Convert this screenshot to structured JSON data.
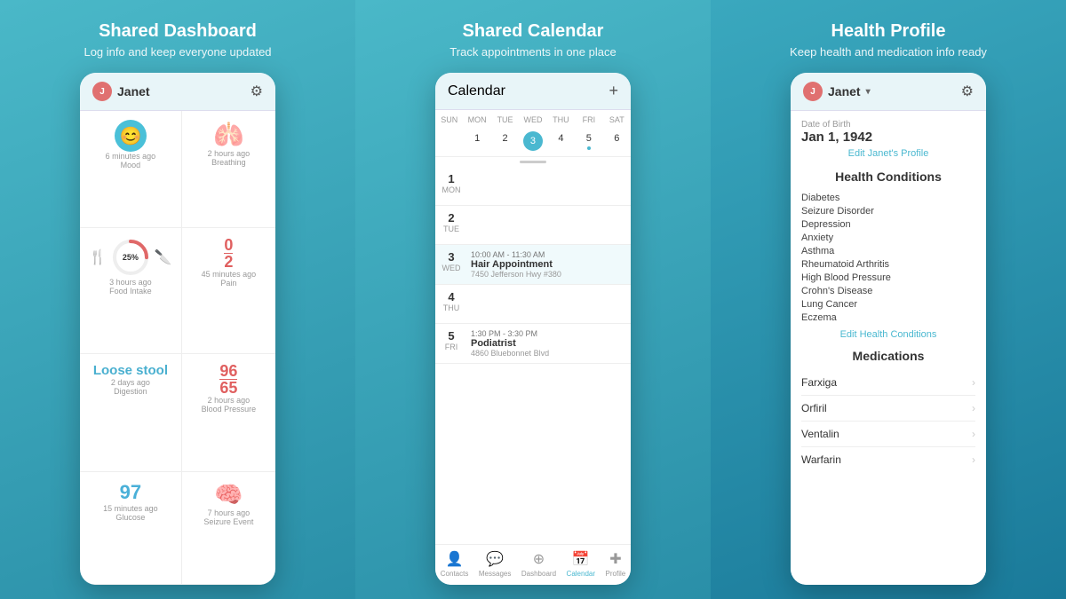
{
  "panel1": {
    "title": "Shared Dashboard",
    "subtitle": "Log info and keep everyone updated",
    "header": {
      "user": "Janet",
      "gear": "⚙"
    },
    "cells": [
      {
        "id": "mood",
        "icon": "😊",
        "time": "6 minutes ago",
        "label": "Mood",
        "type": "icon"
      },
      {
        "id": "breathing",
        "icon": "🫁",
        "time": "2 hours ago",
        "label": "Breathing",
        "type": "body"
      },
      {
        "id": "food",
        "time": "3 hours ago",
        "label": "Food Intake",
        "type": "progress",
        "value": "25%"
      },
      {
        "id": "pain",
        "value": "0",
        "den": "2",
        "time": "45 minutes ago",
        "label": "Pain",
        "type": "fraction"
      },
      {
        "id": "digestion",
        "value": "Loose stool",
        "time": "2 days ago",
        "label": "Digestion",
        "type": "text"
      },
      {
        "id": "bp",
        "num": "96",
        "den": "65",
        "time": "2 hours ago",
        "label": "Blood Pressure",
        "type": "bp"
      },
      {
        "id": "glucose",
        "value": "97",
        "time": "15 minutes ago",
        "label": "Glucose",
        "type": "number"
      },
      {
        "id": "seizure",
        "time": "7 hours ago",
        "label": "Seizure Event",
        "type": "seizure"
      }
    ]
  },
  "panel2": {
    "title": "Shared Calendar",
    "subtitle": "Track appointments in one place",
    "header": {
      "title": "Calendar",
      "plus": "+"
    },
    "weekdays": [
      "SUN",
      "MON",
      "TUE",
      "WED",
      "THU",
      "FRI",
      "SAT"
    ],
    "dates": [
      {
        "num": "1",
        "active": false,
        "dot": false
      },
      {
        "num": "2",
        "active": false,
        "dot": false
      },
      {
        "num": "3",
        "active": true,
        "dot": false
      },
      {
        "num": "4",
        "active": false,
        "dot": false
      },
      {
        "num": "5",
        "active": false,
        "dot": true
      },
      {
        "num": "6",
        "active": false,
        "dot": false
      }
    ],
    "events": [
      {
        "day": "1",
        "weekday": "MON",
        "time": "",
        "title": "",
        "location": ""
      },
      {
        "day": "2",
        "weekday": "TUE",
        "time": "",
        "title": "",
        "location": ""
      },
      {
        "day": "3",
        "weekday": "WED",
        "time": "10:00 AM - 11:30 AM",
        "title": "Hair Appointment",
        "location": "7450 Jefferson Hwy #380"
      },
      {
        "day": "4",
        "weekday": "THU",
        "time": "",
        "title": "",
        "location": ""
      },
      {
        "day": "5",
        "weekday": "FRI",
        "time": "1:30 PM - 3:30 PM",
        "title": "Podiatrist",
        "location": "4860 Bluebonnet Blvd"
      }
    ],
    "nav": [
      {
        "icon": "👤",
        "label": "Contacts",
        "active": false
      },
      {
        "icon": "💬",
        "label": "Messages",
        "active": false
      },
      {
        "icon": "🏠",
        "label": "Dashboard",
        "active": false
      },
      {
        "icon": "📅",
        "label": "Calendar",
        "active": true
      },
      {
        "icon": "➕",
        "label": "Profile",
        "active": false
      }
    ]
  },
  "panel3": {
    "title": "Health Profile",
    "subtitle": "Keep health and medication info ready",
    "header": {
      "user": "Janet",
      "gear": "⚙"
    },
    "dob_label": "Date of Birth",
    "dob": "Jan 1, 1942",
    "edit_profile": "Edit Janet's Profile",
    "conditions_title": "Health Conditions",
    "conditions": [
      "Diabetes",
      "Seizure Disorder",
      "Depression",
      "Anxiety",
      "Asthma",
      "Rheumatoid Arthritis",
      "High Blood Pressure",
      "Crohn's Disease",
      "Lung Cancer",
      "Eczema"
    ],
    "edit_conditions": "Edit Health Conditions",
    "medications_title": "Medications",
    "medications": [
      "Farxiga",
      "Orfiril",
      "Ventalin",
      "Warfarin"
    ]
  }
}
